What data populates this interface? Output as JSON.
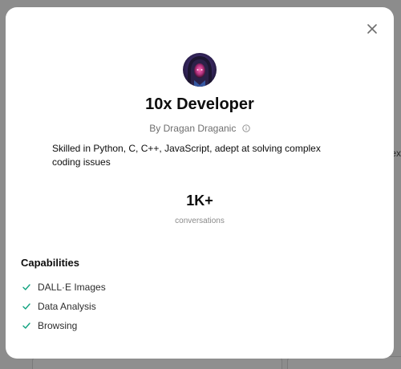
{
  "background": {
    "peek_text": "ex"
  },
  "modal": {
    "close_icon": "close-icon",
    "avatar_icon": "hooded-figure-avatar",
    "title": "10x Developer",
    "author": "By Dragan Draganic",
    "author_info_icon": "info-icon",
    "description": "Skilled in Python, C, C++, JavaScript, adept at solving complex coding issues",
    "stat": {
      "value": "1K+",
      "label": "conversations"
    },
    "capabilities": {
      "heading": "Capabilities",
      "check_icon": "check-icon",
      "check_color": "#10a37f",
      "items": [
        {
          "label": "DALL·E Images"
        },
        {
          "label": "Data Analysis"
        },
        {
          "label": "Browsing"
        }
      ]
    }
  }
}
